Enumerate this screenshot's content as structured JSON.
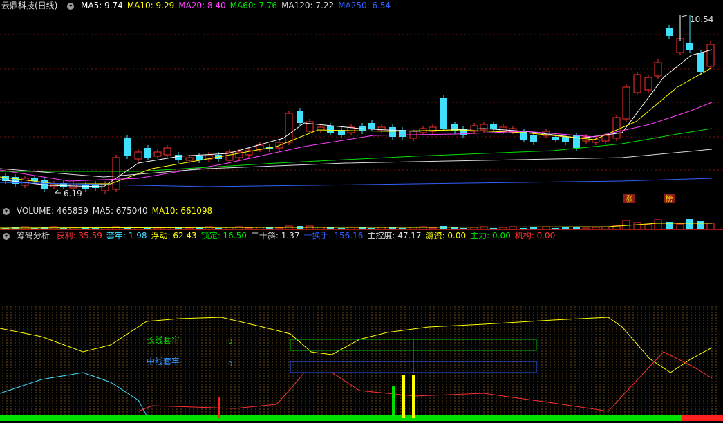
{
  "price": {
    "title": "云鼎科技(日线)",
    "ma": [
      {
        "label": "MA5: 9.74",
        "color": "#ffffff"
      },
      {
        "label": "MA10: 9.29",
        "color": "#ffff00"
      },
      {
        "label": "MA20: 8.40",
        "color": "#ff40ff"
      },
      {
        "label": "MA60: 7.76",
        "color": "#00e000"
      },
      {
        "label": "MA120: 7.22",
        "color": "#dddddd"
      },
      {
        "label": "MA250: 6.54",
        "color": "#3060ff"
      }
    ],
    "high_label": "10.54",
    "low_label": "6.19",
    "tags": [
      "涨",
      "榜"
    ]
  },
  "volume": {
    "items": [
      {
        "label": "VOLUME: 465859",
        "color": "#dddddd"
      },
      {
        "label": "MA5: 675040",
        "color": "#dddddd"
      },
      {
        "label": "MA10: 661098",
        "color": "#ffff00"
      }
    ]
  },
  "chips": {
    "title": "筹码分析",
    "items": [
      {
        "label": "获利: 35.59",
        "color": "#ff3030"
      },
      {
        "label": "套牢: 1.98",
        "color": "#40e0ff"
      },
      {
        "label": "浮动: 62.43",
        "color": "#ffff00"
      },
      {
        "label": "锁定: 16.50",
        "color": "#00e000"
      },
      {
        "label": "二十斜: 1.37",
        "color": "#dddddd"
      },
      {
        "label": "十换手: 156.16",
        "color": "#3060ff"
      },
      {
        "label": "主控度: 47.17",
        "color": "#dddddd"
      },
      {
        "label": "游资: 0.00",
        "color": "#ffff00"
      },
      {
        "label": "主力: 0.00",
        "color": "#00e000"
      },
      {
        "label": "机构: 0.00",
        "color": "#ff3030"
      }
    ],
    "long_label": "长线套牢",
    "long_value": "0",
    "mid_label": "中线套牢",
    "mid_value": "0"
  },
  "colors": {
    "up": "#ff3030",
    "down": "#40e0ff",
    "border": "#a01818"
  }
}
